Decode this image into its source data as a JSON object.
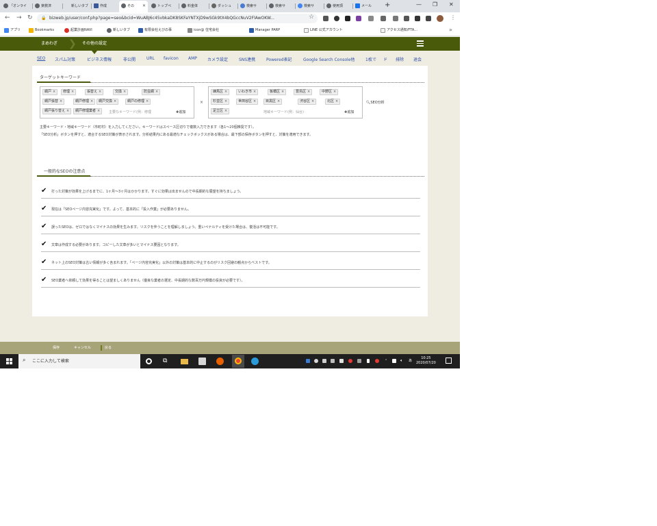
{
  "browser": {
    "tabs": [
      {
        "label": "「オンライ"
      },
      {
        "label": "楽救済"
      },
      {
        "label": "新しいタブ"
      },
      {
        "label": "作成"
      },
      {
        "label": "その"
      },
      {
        "label": "トップペ"
      },
      {
        "label": "料金体"
      },
      {
        "label": "ダッシュ"
      },
      {
        "label": "検索サ"
      },
      {
        "label": "検索サ"
      },
      {
        "label": "検索サ"
      },
      {
        "label": "使用頂"
      },
      {
        "label": "メール"
      }
    ],
    "url": "bizweb.jp/user/conf.php?page=seo&bcid=WuABJ6c45vbkaDK8SKFaYNTXjD9wSGk9tX4bQGccNuV2FlAwOKW...",
    "bookmarks": [
      {
        "label": "アプリ"
      },
      {
        "label": "Bookmarks"
      },
      {
        "label": "起業計画NAVI"
      },
      {
        "label": "新しいタブ"
      },
      {
        "label": "有限会社えびの事"
      },
      {
        "label": "icon@ 住宅会社"
      },
      {
        "label": "Manager PARP"
      },
      {
        "label": "LINE 公式アカウント"
      },
      {
        "label": "アクセス通知/FTA..."
      }
    ]
  },
  "site": {
    "breadcrumb": {
      "home": "まめわぎ",
      "current": "その他の設定"
    },
    "subnav": [
      "SEO",
      "スパム対策",
      "ビジネス情報",
      "非公開",
      "URL",
      "favicon",
      "AMP",
      "カメラ設定",
      "SNS連携",
      "Powered表記",
      "Google Search Console他",
      "1枚で",
      "ド",
      "排除",
      "退会"
    ]
  },
  "target_keywords": {
    "title": "ターゲットキーワード",
    "box1_chips": [
      "網戸",
      "修理",
      "張替え",
      "交換",
      "防虫網",
      "網戸張替",
      "網戸修理",
      "網戸交換",
      "網戸の修理",
      "網戸張り替え",
      "網戸修理業者"
    ],
    "box1_placeholder": "主要なキーワード(例：修理",
    "box2_chips": [
      "練馬区",
      "いわき市",
      "板橋区",
      "豊島区",
      "中野区",
      "杉並区",
      "世田谷区",
      "目黒区",
      "渋谷区",
      "北区",
      "足立区"
    ],
    "box2_placeholder": "地域キーワード(例：仙台)",
    "add_label": "追加",
    "cross": "×",
    "analyze_label": "SEO分析",
    "help_line1": "主要キーワード・地域キーワード（市町村）を入力してください。キーワードはスペース区切りで複数入力できます（各1〜20個推奨です）。",
    "help_line2": "「SEO分析」ボタンを押すと、適合するSEO対策が表示されます。分析結果内にある最適なチェックボックスがある場合は、最下部の保存ボタンを押すと、対策を適用できます。"
  },
  "tips": {
    "title": "一般的なSEOの注意点",
    "items": [
      "打った対策が効果を上げるまでに、1ヶ月〜3ヶ月はかかります。すぐに効果は出ませんので中長期的な展望を持ちましょう。",
      "現在は「SEOページ内容充実化」です。よって、基本的に「投入作業」が必要ありません。",
      "誤ったSEOは、ゼロではなくマイナスの効果を生みます。リスクを伴うことを理解しましょう。重いペナルティを受けた場合は、復活は不可能です。",
      "文章は作成する必要があります。コピーした文章が多いとマイナス要因となります。",
      "ネット上のSEO対策は古い情報が多く含まれます。「ページ内容充実化」以外の対策は基本的に中止するのがリスク回避の観点からベストです。",
      "SEO業者へ依頼して効果を得ることは望ましくありません（優良な業者の選定、中長期的な数百万円規模の投資が必要です）。"
    ]
  },
  "footer": {
    "save": "保存",
    "cancel": "キャンセル",
    "back": "戻る"
  },
  "taskbar": {
    "search_placeholder": "ここに入力して検索",
    "time": "10:25",
    "date": "2020/07/20"
  }
}
